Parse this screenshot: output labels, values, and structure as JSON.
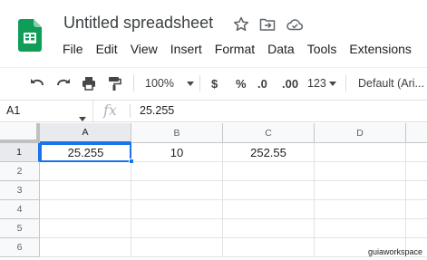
{
  "doc": {
    "title": "Untitled spreadsheet"
  },
  "title_icons": [
    "star-icon",
    "move-to-folder-icon",
    "cloud-saved-icon"
  ],
  "menu": [
    "File",
    "Edit",
    "View",
    "Insert",
    "Format",
    "Data",
    "Tools",
    "Extensions"
  ],
  "toolbar": {
    "zoom": "100%",
    "currency": "$",
    "percent": "%",
    "decrease_decimals": ".0",
    "increase_decimals": ".00",
    "more_formats": "123",
    "font": "Default (Ari..."
  },
  "formula_bar": {
    "name_box": "A1",
    "fx": "fx",
    "value": "25.255"
  },
  "grid": {
    "columns": [
      "A",
      "B",
      "C",
      "D"
    ],
    "rows": [
      "1",
      "2",
      "3",
      "4",
      "5",
      "6"
    ],
    "cells": {
      "A1": "25.255",
      "B1": "10",
      "C1": "252.55"
    },
    "selected": "A1"
  },
  "watermark": "guiaworkspace",
  "colors": {
    "accent": "#1a73e8",
    "sheets_green": "#0f9d58"
  }
}
